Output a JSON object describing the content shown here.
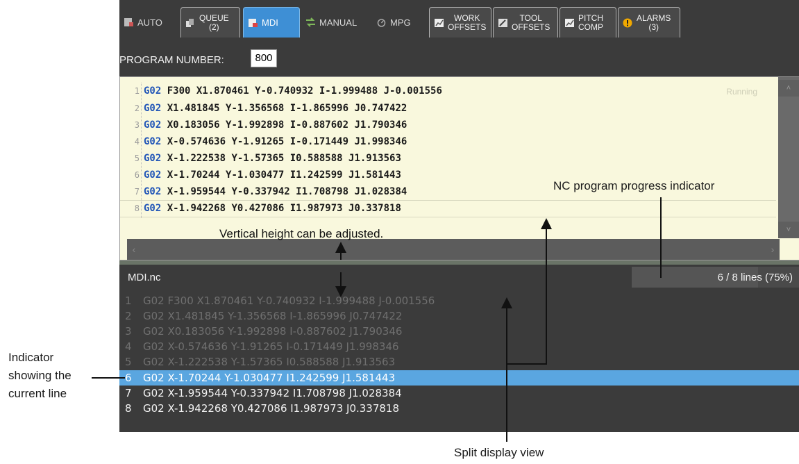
{
  "tabs": [
    {
      "label": "AUTO",
      "label2": "",
      "icon": "auto-icon",
      "style": "plain"
    },
    {
      "label": "QUEUE",
      "label2": "(2)",
      "icon": "queue-icon",
      "style": "boxed"
    },
    {
      "label": "MDI",
      "label2": "",
      "icon": "mdi-icon",
      "style": "active"
    },
    {
      "label": "MANUAL",
      "label2": "",
      "icon": "manual-arrows-icon",
      "style": "plain"
    },
    {
      "label": "MPG",
      "label2": "",
      "icon": "mpg-dial-icon",
      "style": "plain"
    },
    {
      "label": "WORK",
      "label2": "OFFSETS",
      "icon": "work-offsets-icon",
      "style": "boxed"
    },
    {
      "label": "TOOL",
      "label2": "OFFSETS",
      "icon": "tool-offsets-icon",
      "style": "boxed"
    },
    {
      "label": "PITCH",
      "label2": "COMP",
      "icon": "pitch-comp-icon",
      "style": "boxed"
    },
    {
      "label": "ALARMS",
      "label2": "(3)",
      "icon": "alarm-warning-icon",
      "style": "boxed"
    }
  ],
  "program": {
    "label": "PROGRAM NUMBER:",
    "value": "800"
  },
  "editor": {
    "status": "Running",
    "lines": [
      {
        "n": "1",
        "g": "G02",
        "rest": " F300 X1.870461 Y-0.740932 I-1.999488 J-0.001556"
      },
      {
        "n": "2",
        "g": "G02",
        "rest": " X1.481845 Y-1.356568 I-1.865996 J0.747422"
      },
      {
        "n": "3",
        "g": "G02",
        "rest": " X0.183056 Y-1.992898 I-0.887602 J1.790346"
      },
      {
        "n": "4",
        "g": "G02",
        "rest": " X-0.574636 Y-1.91265 I-0.171449 J1.998346"
      },
      {
        "n": "5",
        "g": "G02",
        "rest": " X-1.222538 Y-1.57365 I0.588588 J1.913563"
      },
      {
        "n": "6",
        "g": "G02",
        "rest": " X-1.70244 Y-1.030477 I1.242599 J1.581443"
      },
      {
        "n": "7",
        "g": "G02",
        "rest": " X-1.959544 Y-0.337942 I1.708798 J1.028384"
      },
      {
        "n": "8",
        "g": "G02",
        "rest": " X-1.942268 Y0.427086 I1.987973 J0.337818"
      }
    ]
  },
  "lower": {
    "filename": "MDI.nc",
    "progress_text": "6 / 8 lines (75%)",
    "progress_fraction": 0.75,
    "current_line": 6,
    "lines": [
      {
        "n": "1",
        "text": "G02 F300 X1.870461 Y-0.740932 I-1.999488 J-0.001556"
      },
      {
        "n": "2",
        "text": "G02 X1.481845 Y-1.356568 I-1.865996 J0.747422"
      },
      {
        "n": "3",
        "text": "G02 X0.183056 Y-1.992898 I-0.887602 J1.790346"
      },
      {
        "n": "4",
        "text": "G02 X-0.574636 Y-1.91265 I-0.171449 J1.998346"
      },
      {
        "n": "5",
        "text": "G02 X-1.222538 Y-1.57365 I0.588588 J1.913563"
      },
      {
        "n": "6",
        "text": "G02 X-1.70244 Y-1.030477 I1.242599 J1.581443"
      },
      {
        "n": "7",
        "text": "G02 X-1.959544 Y-0.337942 I1.708798 J1.028384"
      },
      {
        "n": "8",
        "text": "G02 X-1.942268 Y0.427086 I1.987973 J0.337818"
      }
    ]
  },
  "annotations": {
    "progress_indicator": "NC program progress indicator",
    "vertical_height": "Vertical height can be adjusted.",
    "current_line_1": "Indicator",
    "current_line_2": "showing the",
    "current_line_3": "current line",
    "split_view": "Split display view"
  },
  "colors": {
    "accent": "#3e8fd5",
    "current_line": "#5aa6e0",
    "editor_bg": "#f9f8dd",
    "app_bg": "#3b3b3b",
    "gcode": "#2256b8"
  }
}
